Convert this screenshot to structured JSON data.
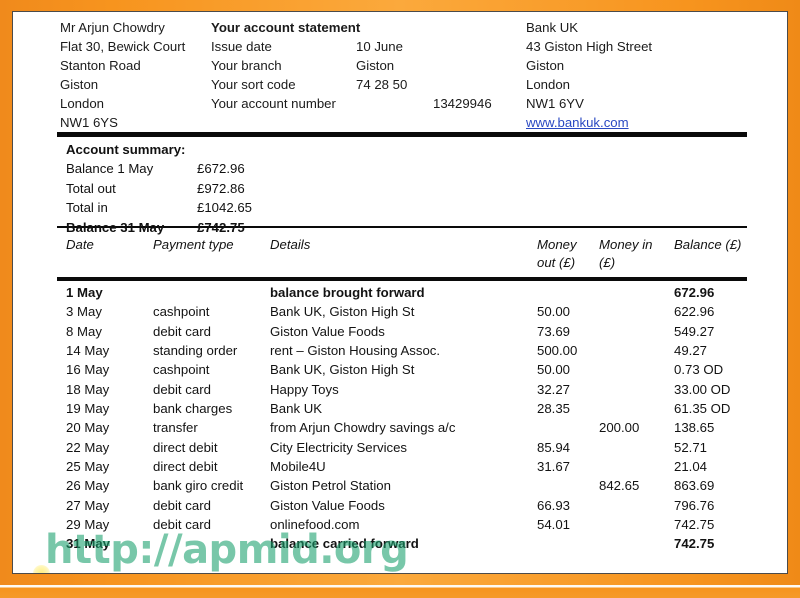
{
  "document": {
    "kind": "bank-statement",
    "accent_orange": "#f7941e",
    "link_color": "#2a49c2",
    "watermark": {
      "text": "http://apmid.org",
      "color": "#169e6b"
    }
  },
  "customer": {
    "lines": [
      "Mr Arjun Chowdry",
      "Flat 30, Bewick Court",
      "Stanton Road",
      "Giston",
      "London",
      "NW1 6YS"
    ]
  },
  "statement": {
    "title": "Your account statement",
    "fields": [
      {
        "label": "Issue date",
        "value": "10 June"
      },
      {
        "label": "Your branch",
        "value": "Giston"
      },
      {
        "label": "Your sort code",
        "value": "74 28 50"
      },
      {
        "label": "Your account number",
        "value": "13429946"
      }
    ]
  },
  "bank": {
    "lines": [
      "Bank UK",
      "43 Giston High Street",
      "Giston",
      "London",
      "NW1 6YV"
    ],
    "website": "www.bankuk.com"
  },
  "summary": {
    "title": "Account summary:",
    "rows": [
      {
        "label": "Balance 1 May",
        "value": "£672.96",
        "bold": false
      },
      {
        "label": "Total out",
        "value": "£972.86",
        "bold": false
      },
      {
        "label": "Total in",
        "value": "£1042.65",
        "bold": false
      },
      {
        "label": "Balance 31 May",
        "value": "£742.75",
        "bold": true
      }
    ]
  },
  "transactions": {
    "headers": {
      "date": "Date",
      "payment_type": "Payment type",
      "details": "Details",
      "money_out": "Money\nout (£)",
      "money_in": "Money in\n(£)",
      "balance": "Balance (£)"
    },
    "rows": [
      {
        "date": "1 May",
        "type": "",
        "details": "balance brought forward",
        "out": "",
        "in": "",
        "balance": "672.96",
        "bold": true
      },
      {
        "date": "3 May",
        "type": "cashpoint",
        "details": "Bank UK, Giston High St",
        "out": "50.00",
        "in": "",
        "balance": "622.96",
        "bold": false
      },
      {
        "date": "8 May",
        "type": "debit card",
        "details": "Giston Value Foods",
        "out": "73.69",
        "in": "",
        "balance": "549.27",
        "bold": false
      },
      {
        "date": "14 May",
        "type": "standing order",
        "details": "rent – Giston Housing Assoc.",
        "out": "500.00",
        "in": "",
        "balance": "49.27",
        "bold": false
      },
      {
        "date": "16 May",
        "type": "cashpoint",
        "details": "Bank UK, Giston High St",
        "out": "50.00",
        "in": "",
        "balance": "0.73 OD",
        "bold": false
      },
      {
        "date": "18 May",
        "type": "debit card",
        "details": "Happy Toys",
        "out": "32.27",
        "in": "",
        "balance": "33.00 OD",
        "bold": false
      },
      {
        "date": "19 May",
        "type": "bank charges",
        "details": "Bank UK",
        "out": "28.35",
        "in": "",
        "balance": "61.35 OD",
        "bold": false
      },
      {
        "date": "20 May",
        "type": "transfer",
        "details": "from Arjun Chowdry savings a/c",
        "out": "",
        "in": "200.00",
        "balance": "138.65",
        "bold": false
      },
      {
        "date": "22 May",
        "type": "direct debit",
        "details": "City Electricity Services",
        "out": "85.94",
        "in": "",
        "balance": "52.71",
        "bold": false
      },
      {
        "date": "25 May",
        "type": "direct debit",
        "details": "Mobile4U",
        "out": "31.67",
        "in": "",
        "balance": "21.04",
        "bold": false
      },
      {
        "date": "26 May",
        "type": "bank giro credit",
        "details": "Giston Petrol Station",
        "out": "",
        "in": "842.65",
        "balance": "863.69",
        "bold": false
      },
      {
        "date": "27 May",
        "type": "debit card",
        "details": "Giston Value Foods",
        "out": "66.93",
        "in": "",
        "balance": "796.76",
        "bold": false
      },
      {
        "date": "29 May",
        "type": "debit card",
        "details": "onlinefood.com",
        "out": "54.01",
        "in": "",
        "balance": "742.75",
        "bold": false
      },
      {
        "date": "31 May",
        "type": "",
        "details": "balance carried forward",
        "out": "",
        "in": "",
        "balance": "742.75",
        "bold": true
      }
    ]
  }
}
